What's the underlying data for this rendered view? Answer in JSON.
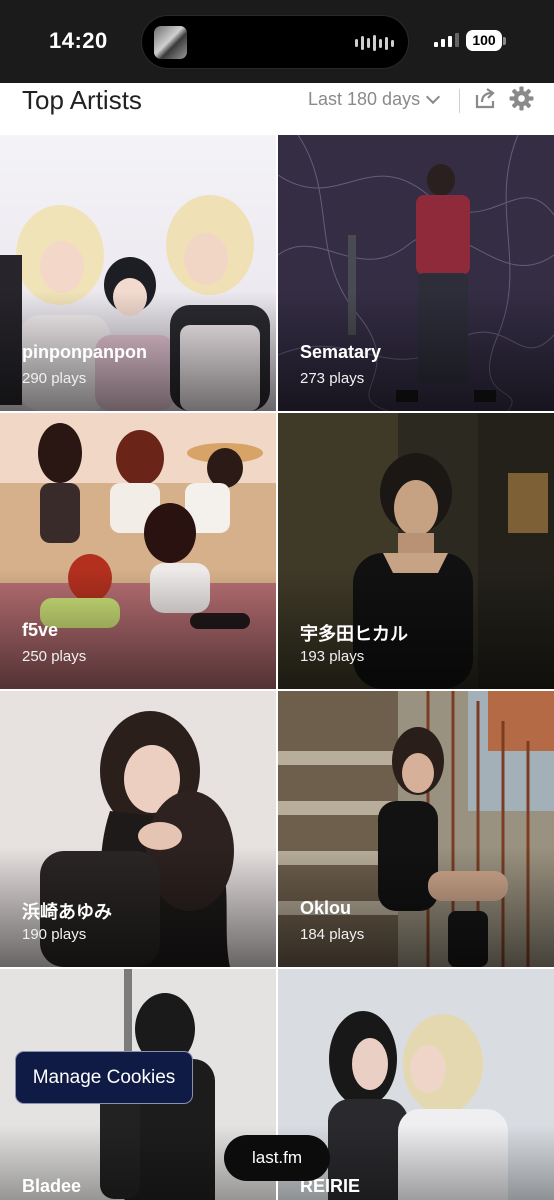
{
  "status_bar": {
    "time": "14:20",
    "battery": "100",
    "icons": [
      "now-playing-thumbnail",
      "waveform-icon",
      "cellular-signal-icon",
      "battery-icon"
    ]
  },
  "header": {
    "title": "Top Artists",
    "range": "Last 180 days",
    "icons": [
      "chevron-down-icon",
      "share-icon",
      "gear-icon"
    ]
  },
  "artists": [
    {
      "name": "pinponpanpon",
      "plays": "290 plays"
    },
    {
      "name": "Sematary",
      "plays": "273 plays"
    },
    {
      "name": "f5ve",
      "plays": "250 plays"
    },
    {
      "name": "宇多田ヒカル",
      "plays": "193 plays"
    },
    {
      "name": "浜崎あゆみ",
      "plays": "190 plays"
    },
    {
      "name": "Oklou",
      "plays": "184 plays"
    },
    {
      "name": "Bladee",
      "plays": ""
    },
    {
      "name": "REIRIE",
      "plays": ""
    }
  ],
  "cookies": {
    "label": "Manage Cookies"
  },
  "site_pill": {
    "label": "last.fm"
  }
}
